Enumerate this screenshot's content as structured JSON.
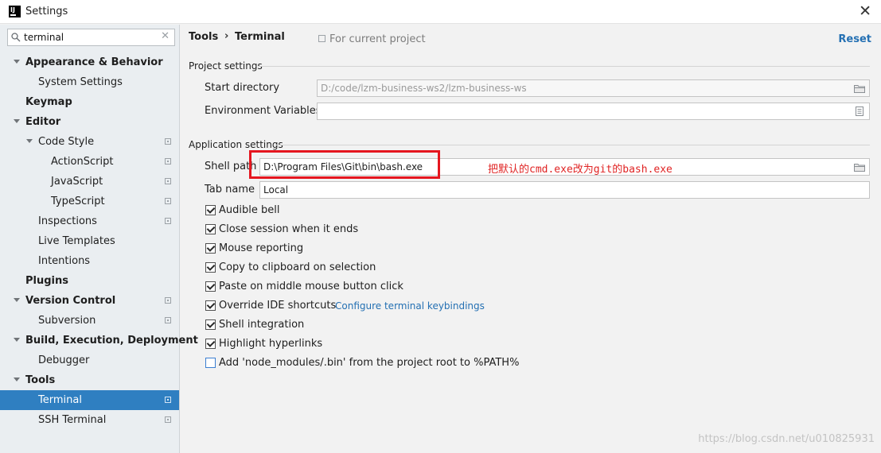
{
  "window": {
    "title": "Settings",
    "logo_text": "IJ",
    "close_glyph": "✕"
  },
  "search": {
    "value": "terminal",
    "clear_glyph": "✕"
  },
  "sidebar": {
    "items": [
      {
        "label": "Appearance & Behavior",
        "level": 0,
        "bold": true,
        "expanded": true
      },
      {
        "label": "System Settings",
        "level": 1
      },
      {
        "label": "Keymap",
        "level": 0,
        "bold": true
      },
      {
        "label": "Editor",
        "level": 0,
        "bold": true,
        "expanded": true
      },
      {
        "label": "Code Style",
        "level": 1,
        "expanded": true,
        "project": true
      },
      {
        "label": "ActionScript",
        "level": 2,
        "project": true
      },
      {
        "label": "JavaScript",
        "level": 2,
        "project": true
      },
      {
        "label": "TypeScript",
        "level": 2,
        "project": true
      },
      {
        "label": "Inspections",
        "level": 1,
        "project": true
      },
      {
        "label": "Live Templates",
        "level": 1
      },
      {
        "label": "Intentions",
        "level": 1
      },
      {
        "label": "Plugins",
        "level": 0,
        "bold": true
      },
      {
        "label": "Version Control",
        "level": 0,
        "bold": true,
        "expanded": true,
        "project": true
      },
      {
        "label": "Subversion",
        "level": 1,
        "project": true
      },
      {
        "label": "Build, Execution, Deployment",
        "level": 0,
        "bold": true,
        "expanded": true
      },
      {
        "label": "Debugger",
        "level": 1
      },
      {
        "label": "Tools",
        "level": 0,
        "bold": true,
        "expanded": true
      },
      {
        "label": "Terminal",
        "level": 1,
        "selected": true,
        "project": true
      },
      {
        "label": "SSH Terminal",
        "level": 1,
        "project": true
      }
    ]
  },
  "breadcrumb": {
    "parent": "Tools",
    "separator": "›",
    "current": "Terminal"
  },
  "scope": {
    "label": "For current project"
  },
  "reset": {
    "label": "Reset"
  },
  "project_settings": {
    "title": "Project settings",
    "start_directory": {
      "label": "Start directory",
      "value": "D:/code/lzm-business-ws2/lzm-business-ws"
    },
    "env_vars": {
      "label": "Environment Variables",
      "value": ""
    }
  },
  "application_settings": {
    "title": "Application settings",
    "shell_path": {
      "label": "Shell path",
      "value": "D:\\Program Files\\Git\\bin\\bash.exe"
    },
    "tab_name": {
      "label": "Tab name",
      "value": "Local"
    },
    "options": [
      {
        "label": "Audible bell",
        "checked": true
      },
      {
        "label": "Close session when it ends",
        "checked": true
      },
      {
        "label": "Mouse reporting",
        "checked": true
      },
      {
        "label": "Copy to clipboard on selection",
        "checked": true
      },
      {
        "label": "Paste on middle mouse button click",
        "checked": true
      },
      {
        "label": "Override IDE shortcuts",
        "checked": true
      },
      {
        "label": "Shell integration",
        "checked": true
      },
      {
        "label": "Highlight hyperlinks",
        "checked": true
      },
      {
        "label": "Add 'node_modules/.bin' from the project root to %PATH%",
        "checked": false
      }
    ],
    "keybindings_link": "Configure terminal keybindings"
  },
  "annotation": {
    "text": "把默认的cmd.exe改为git的bash.exe",
    "color": "#e02424"
  },
  "watermark": {
    "text": "https://blog.csdn.net/u010825931"
  },
  "colors": {
    "accent": "#2f7fc1",
    "link": "#2470b3",
    "highlight": "#e5161f"
  }
}
